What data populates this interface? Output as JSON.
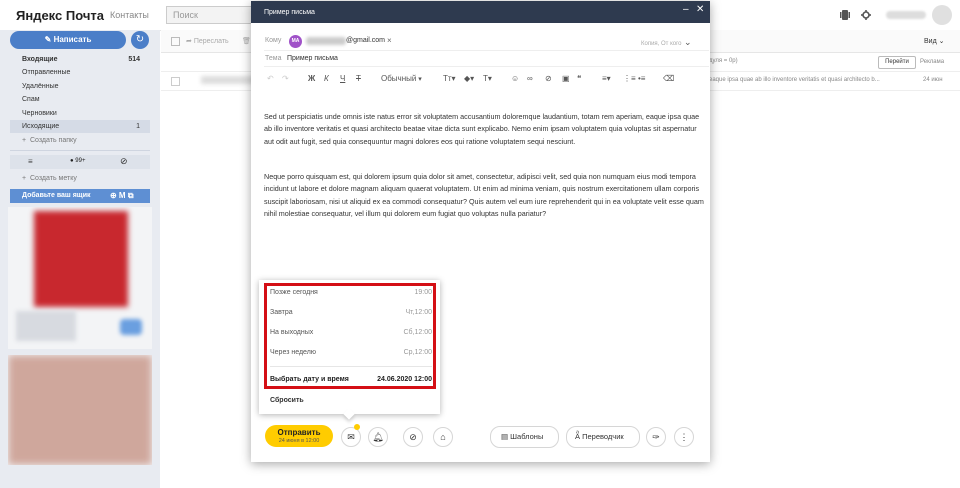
{
  "header": {
    "logo": "Яндекс Почта",
    "contacts": "Контакты",
    "search_placeholder": "Поиск"
  },
  "sidebar": {
    "compose": "Написать",
    "folders": [
      {
        "label": "Входящие",
        "count": "514",
        "bold": true
      },
      {
        "label": "Отправленные",
        "count": ""
      },
      {
        "label": "Удалённые",
        "count": ""
      },
      {
        "label": "Спам",
        "count": ""
      },
      {
        "label": "Черновики",
        "count": ""
      },
      {
        "label": "Исходящие",
        "count": "1",
        "selected": true
      }
    ],
    "create_folder": "Создать папку",
    "unread_badge": "99+",
    "create_label": "Создать метку",
    "add_mailbox": "Добавьте ваш ящик"
  },
  "toolbar": {
    "forward": "Переслать",
    "view": "Вид"
  },
  "list": {
    "row_snippet": "eaque ipsa quae ab illo inventore veritatis et quasi architecto b...",
    "row_date": "24 июн",
    "search_hint": "дуля = 0р)",
    "goto": "Перейти",
    "ads": "Реклама"
  },
  "compose": {
    "title": "Пример письма",
    "to_label": "Кому",
    "to_initials": "МА",
    "to_domain": "@gmail.com",
    "copy_toggle": "Копия, От кого",
    "subject_label": "Тема",
    "subject": "Пример письма",
    "font_select": "Обычный",
    "body": [
      "Sed ut perspiciatis unde omnis iste natus error sit voluptatem accusantium doloremque laudantium, totam rem aperiam, eaque ipsa quae ab illo inventore veritatis et quasi architecto beatae vitae dicta sunt explicabo. Nemo enim ipsam voluptatem quia voluptas sit aspernatur aut odit aut fugit, sed quia consequuntur magni dolores eos qui ratione voluptatem sequi nesciunt.",
      "Neque porro quisquam est, qui dolorem ipsum quia dolor sit amet, consectetur, adipisci velit, sed quia non numquam eius modi tempora incidunt ut labore et dolore magnam aliquam quaerat voluptatem. Ut enim ad minima veniam, quis nostrum exercitationem ullam corporis suscipit laboriosam, nisi ut aliquid ex ea commodi consequatur? Quis autem vel eum iure reprehenderit qui in ea voluptate velit esse quam nihil molestiae consequatur, vel illum qui dolorem eum fugiat quo voluptas nulla pariatur?"
    ],
    "send": "Отправить",
    "send_sub": "24 июня в 12:00",
    "templates": "Шаблоны",
    "translator": "Переводчик"
  },
  "schedule_popup": {
    "options": [
      {
        "label": "Позже сегодня",
        "time": "19:00"
      },
      {
        "label": "Завтра",
        "time": "Чт,12:00"
      },
      {
        "label": "На выходных",
        "time": "Сб,12:00"
      },
      {
        "label": "Через неделю",
        "time": "Ср,12:00"
      }
    ],
    "choose": "Выбрать дату и время",
    "choose_value": "24.06.2020 12:00",
    "reset": "Сбросить"
  }
}
